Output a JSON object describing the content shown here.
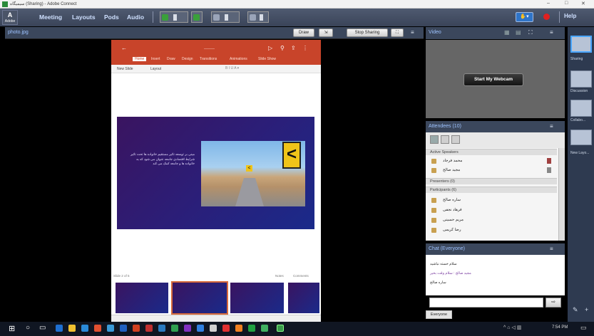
{
  "window": {
    "title": "ﺳﯿﻤﯿﮕﺎه (Sharing) - Adobe Connect",
    "minimize": "–",
    "maximize": "□",
    "close": "✕"
  },
  "logo": {
    "text": "A",
    "sub": "Adobe"
  },
  "menu": {
    "meeting": "Meeting",
    "layouts": "Layouts",
    "pods": "Pods",
    "audio": "Audio",
    "help": "Help"
  },
  "status": {
    "label": "✋▾"
  },
  "share_pod": {
    "name": "photo.jpg",
    "draw_label": "Draw",
    "stop_label": "Stop Sharing"
  },
  "slide_app": {
    "tabs": [
      "Home",
      "Insert",
      "Draw",
      "Design",
      "Transitions",
      "Animations",
      "Slide Show"
    ],
    "sub_left": "New Slide",
    "sub_right": "Layout",
    "slide_text": "ﻣﯿﻨﯽ ﺑﺮ ﺗﻮﺳﻌﻪ ﺗﺎﺛﯿﺮ ﻣﺴﺘﻘﯿﻢ ﺧﺎﻧﻮاده ﻫﺎ ﺗﺤﺖ ﺗﺎﺛﯿﺮ ﺷﺮاﯾﻂ اﻗﺘﺼﺎدی ﺟﺎﻣﻌﻪ ﻋﻨﻮان ﻣﯽ ﺷﻮد ﮐﻪ ﺑﻪ ﺧﺎﻧﻮاده ﻫﺎ و ﺟﺎﻣﻌﻪ ﮐﻤﮏ ﻣﯽ ﮐﻨﺪ",
    "slide_counter": "Slide 2 of 5",
    "notes": "Notes",
    "comments": "Comments"
  },
  "video_pod": {
    "name": "Video",
    "start_label": "Start My Webcam"
  },
  "attendees_pod": {
    "name": "Attendees (10)",
    "active_speakers": "Active Speakers",
    "hosts": [
      {
        "name": "ﻣﺤﻤﺪ ﻓﺮﺟﺎد"
      },
      {
        "name": "ﻣﺠﯿﺪ ﺻﺎﻟﺢ"
      }
    ],
    "presenters_label": "Presenters (0)",
    "participants_label": "Participants (6)",
    "participants": [
      {
        "name": "ﺳﺎره ﺻﺎﻟﺢ"
      },
      {
        "name": "ﻓﺮﻫﺎد ﻧﺠﻔﯽ"
      },
      {
        "name": "ﻣﺮﯾﻢ ﺣﺴﯿﻨﯽ"
      },
      {
        "name": "رﺿﺎ ﮐﺮﯾﻤﯽ"
      }
    ]
  },
  "chat_pod": {
    "name": "Chat (Everyone)",
    "messages": [
      {
        "text": "ﺳﻼم ﺧﺴﺘﻪ ﻧﺒﺎﺷﯿﺪ"
      },
      {
        "text": "ﻣﺠﯿﺪ ﺻﺎﻟﺢ : ﺳﻼم وﻗﺖ ﺑﺨﯿﺮ"
      },
      {
        "text": "ﺳﺎره ﺻﺎﻟﺢ"
      }
    ],
    "send": "⇨",
    "everyone_tab": "Everyone"
  },
  "layouts_sidebar": {
    "items": [
      {
        "label": "Sharing"
      },
      {
        "label": "Discussion"
      },
      {
        "label": "Collabo..."
      },
      {
        "label": "New Layo..."
      }
    ]
  },
  "taskbar": {
    "time": "7:54 PM"
  }
}
